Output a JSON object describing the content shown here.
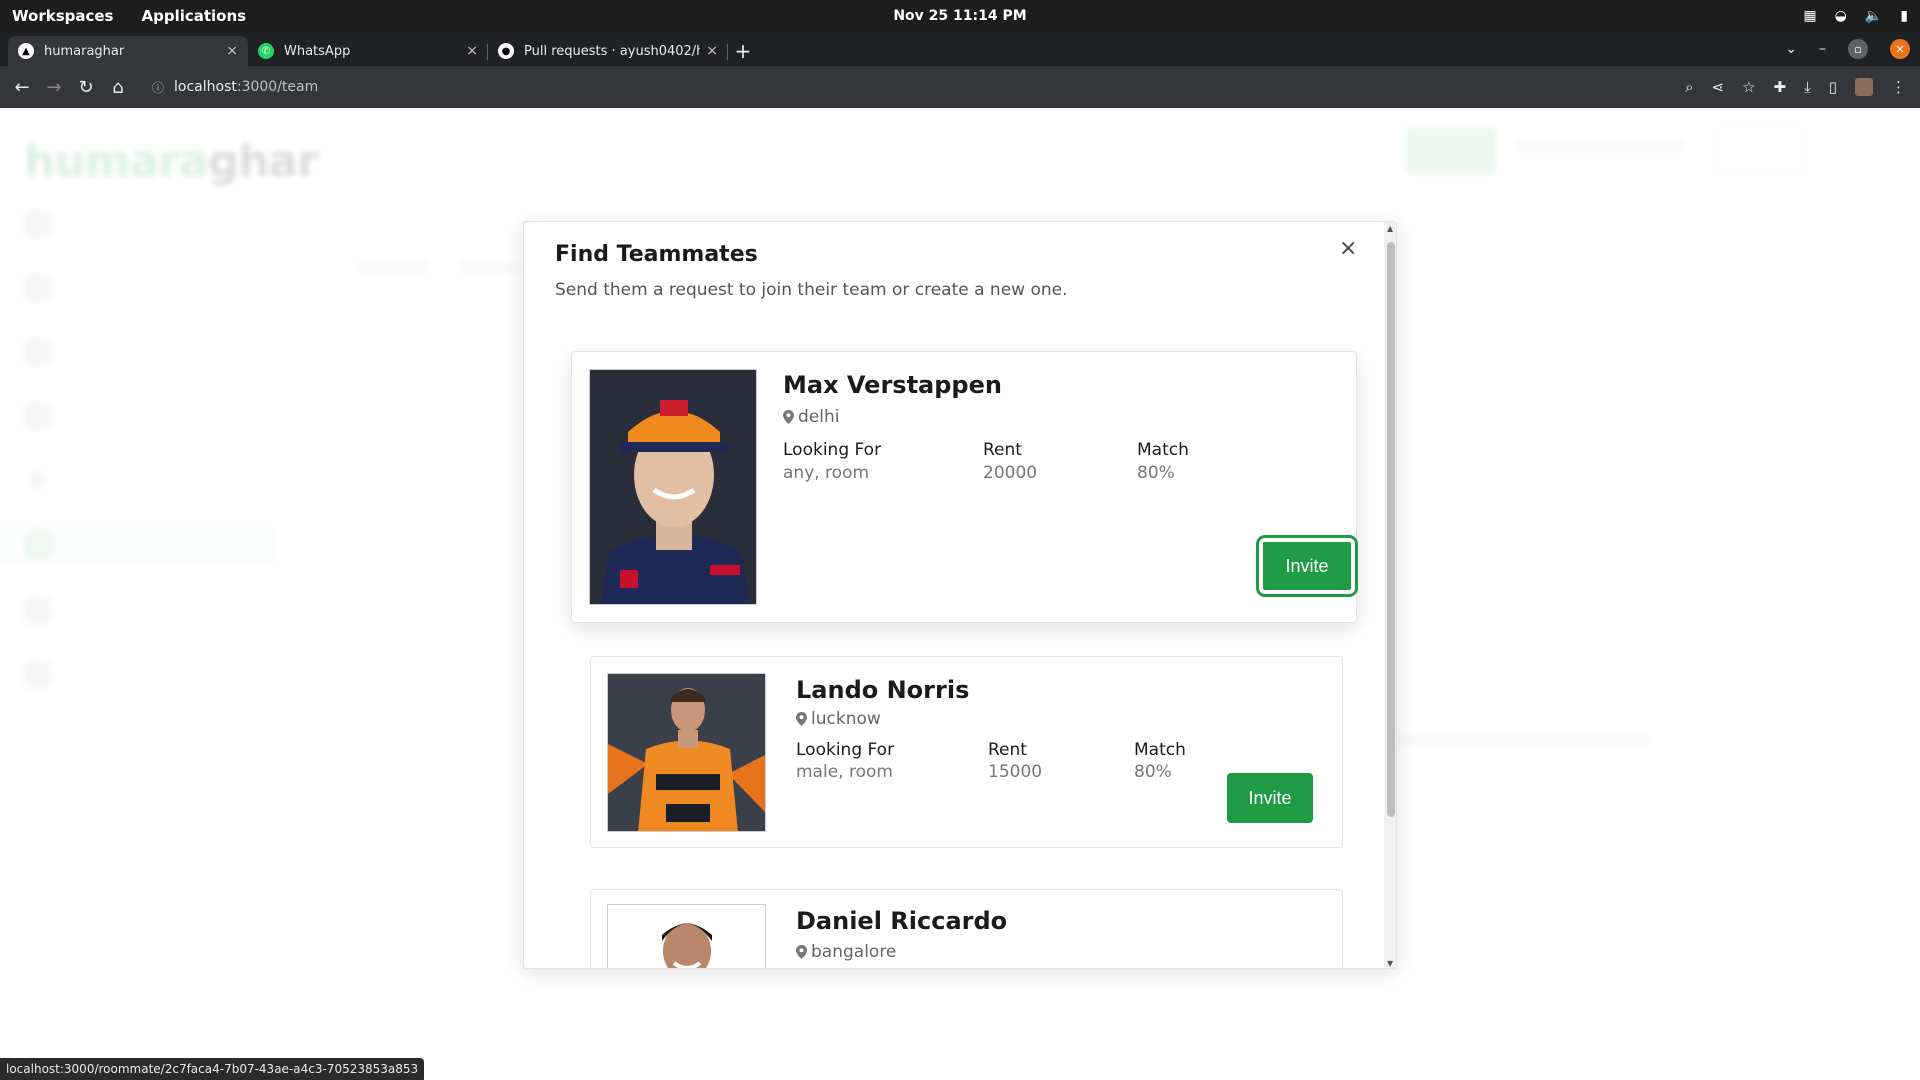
{
  "os": {
    "workspaces": "Workspaces",
    "applications": "Applications",
    "clock": "Nov 25  11:14 PM"
  },
  "tabs": [
    {
      "title": "humaraghar",
      "close": "×"
    },
    {
      "title": "WhatsApp",
      "close": "×"
    },
    {
      "title": "Pull requests · ayush0402/hu",
      "close": "×"
    }
  ],
  "toolbar": {
    "url_host": "localhost",
    "url_rest": ":3000/team"
  },
  "background": {
    "logo_green": "humara",
    "logo_dark": "ghar"
  },
  "modal": {
    "title": "Find Teammates",
    "subtitle": "Send them a request to join their team or create a new one.",
    "close": "×"
  },
  "cards": [
    {
      "name": "Max Verstappen",
      "location": "delhi",
      "looking_for_label": "Looking For",
      "looking_for": "any, room",
      "rent_label": "Rent",
      "rent": "20000",
      "match_label": "Match",
      "match": "80%",
      "invite": "Invite"
    },
    {
      "name": "Lando Norris",
      "location": "lucknow",
      "looking_for_label": "Looking For",
      "looking_for": "male, room",
      "rent_label": "Rent",
      "rent": "15000",
      "match_label": "Match",
      "match": "80%",
      "invite": "Invite"
    },
    {
      "name": "Daniel Riccardo",
      "location": "bangalore"
    }
  ],
  "status_url": "localhost:3000/roommate/2c7faca4-7b07-43ae-a4c3-70523853a853"
}
